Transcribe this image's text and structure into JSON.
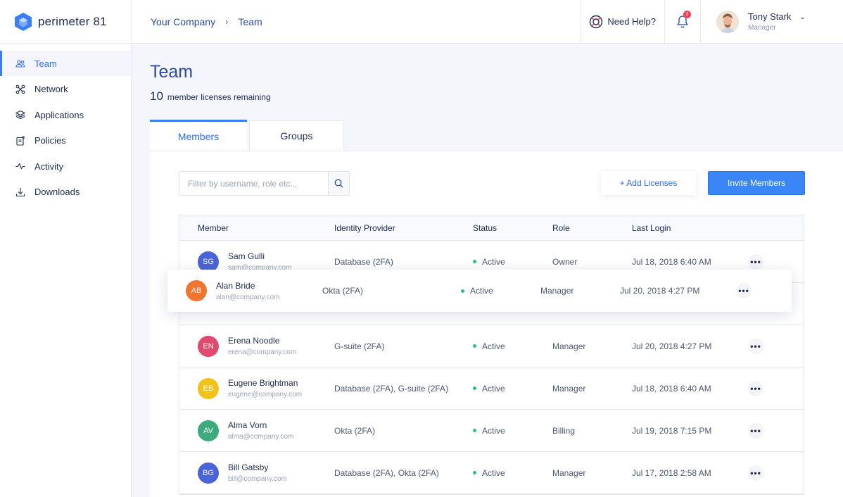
{
  "brand": {
    "name": "perimeter 81"
  },
  "sidebar": {
    "items": [
      {
        "label": "Team",
        "icon": "team-icon",
        "active": true
      },
      {
        "label": "Network",
        "icon": "network-icon"
      },
      {
        "label": "Applications",
        "icon": "applications-icon"
      },
      {
        "label": "Policies",
        "icon": "policies-icon"
      },
      {
        "label": "Activity",
        "icon": "activity-icon"
      },
      {
        "label": "Downloads",
        "icon": "downloads-icon"
      }
    ]
  },
  "header": {
    "breadcrumb": [
      "Your Company",
      "Team"
    ],
    "help_label": "Need Help?",
    "notifications_count": "2",
    "user": {
      "name": "Tony Stark",
      "role": "Manager"
    }
  },
  "page": {
    "title": "Team",
    "licenses_count": "10",
    "licenses_text": "member licenses remaining",
    "tabs": [
      {
        "label": "Members",
        "active": true
      },
      {
        "label": "Groups"
      }
    ],
    "search_placeholder": "Filter by username, role etc...",
    "add_licenses_label": "+ Add Licenses",
    "invite_label": "Invite Members"
  },
  "table": {
    "columns": [
      "Member",
      "Identity Provider",
      "Status",
      "Role",
      "Last Login"
    ],
    "rows": [
      {
        "initials": "SG",
        "color": "#4a63d8",
        "name": "Sam Gulli",
        "email": "sam@company.com",
        "idp": "Database (2FA)",
        "status": "Active",
        "role": "Owner",
        "last_login": "Jul 18, 2018 6:40 AM"
      },
      {
        "initials": "EN",
        "color": "#e14a6e",
        "name": "Erena Noodle",
        "email": "erena@company.com",
        "idp": "G-suite (2FA)",
        "status": "Active",
        "role": "Manager",
        "last_login": "Jul 20, 2018 4:27 PM"
      },
      {
        "initials": "EB",
        "color": "#f2c21a",
        "name": "Eugene Brightman",
        "email": "eugene@company.com",
        "idp": "Database (2FA), G-suite (2FA)",
        "status": "Active",
        "role": "Manager",
        "last_login": "Jul 18, 2018 6:40 AM"
      },
      {
        "initials": "AV",
        "color": "#3caa7a",
        "name": "Alma Vorn",
        "email": "alma@company.com",
        "idp": "Okta (2FA)",
        "status": "Active",
        "role": "Billing",
        "last_login": "Jul 19, 2018 7:15 PM"
      },
      {
        "initials": "BG",
        "color": "#4a63d8",
        "name": "Bill Gatsby",
        "email": "bill@company.com",
        "idp": "Database (2FA), Okta (2FA)",
        "status": "Active",
        "role": "Manager",
        "last_login": "Jul 17, 2018 2:58 AM"
      }
    ],
    "dragging": {
      "initials": "AB",
      "color": "#f0752e",
      "name": "Alan Bride",
      "email": "alan@company.com",
      "idp": "Okta (2FA)",
      "status": "Active",
      "role": "Manager",
      "last_login": "Jul 20, 2018 4:27 PM"
    }
  }
}
